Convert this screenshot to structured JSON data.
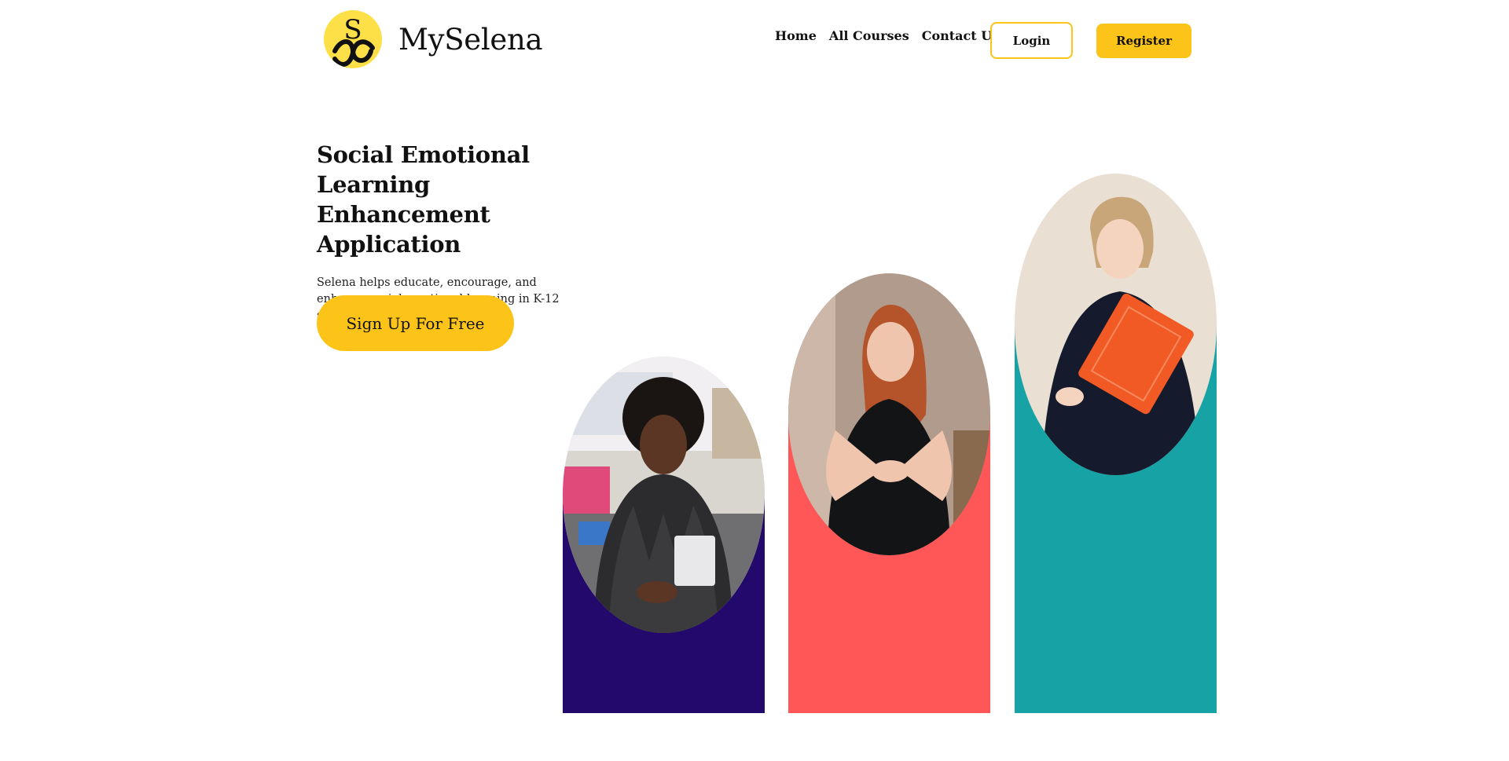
{
  "header": {
    "brand_name": "MySelena",
    "logo_letter": "S",
    "nav": [
      "Home",
      "All Courses",
      "Contact Us"
    ],
    "login_label": "Login",
    "register_label": "Register"
  },
  "hero": {
    "title": "Social Emotional Learning Enhancement Application",
    "subtitle": "Selena helps educate, encourage, and enhance social emotional learning in K-12 schools.",
    "cta_label": "Sign Up For Free"
  },
  "colors": {
    "accent": "#fcc419",
    "logo_bg": "#fde047",
    "pillar_1": "#23096b",
    "pillar_2": "#ff5757",
    "pillar_3": "#17a2a5"
  },
  "images": [
    {
      "icon": "teacher-photo-1"
    },
    {
      "icon": "teacher-photo-2"
    },
    {
      "icon": "teacher-photo-3"
    }
  ]
}
